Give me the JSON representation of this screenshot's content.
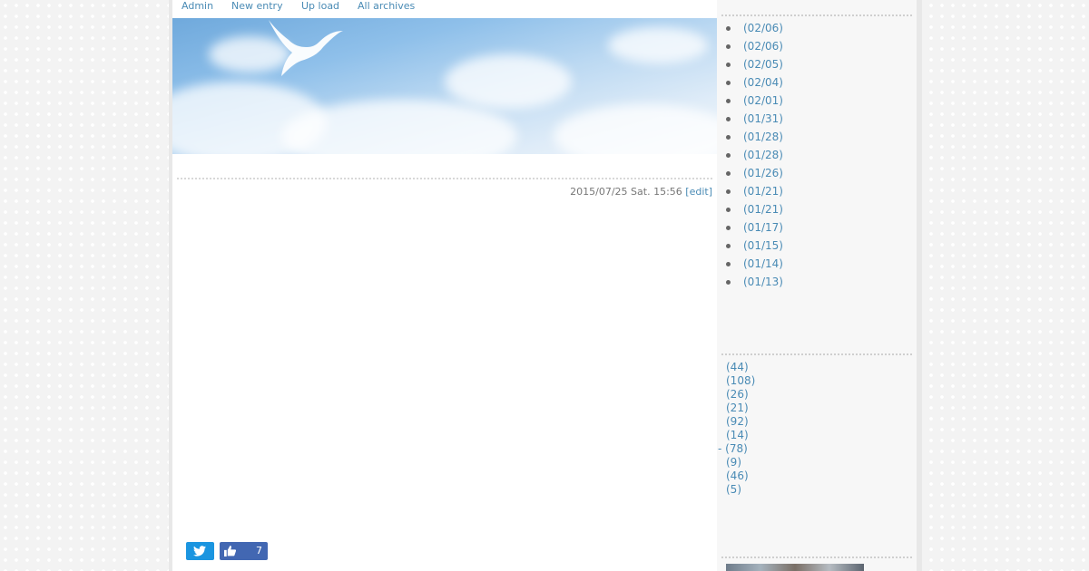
{
  "topnav": {
    "items": [
      {
        "label": "Admin"
      },
      {
        "label": "New entry"
      },
      {
        "label": "Up load"
      },
      {
        "label": "All archives"
      }
    ]
  },
  "entry": {
    "date": "2015/07/25 Sat. 15:56",
    "edit_label": "[edit]",
    "like_count": "7"
  },
  "sidebar": {
    "recent_dates": [
      "(02/06)",
      "(02/06)",
      "(02/05)",
      "(02/04)",
      "(02/01)",
      "(01/31)",
      "(01/28)",
      "(01/28)",
      "(01/26)",
      "(01/21)",
      "(01/21)",
      "(01/17)",
      "(01/15)",
      "(01/14)",
      "(01/13)"
    ],
    "category_counts": [
      "(44)",
      "(108)",
      "(26)",
      "(21)",
      "(92)",
      "(14)",
      "- (78)",
      "(9)",
      "(46)",
      "(5)"
    ]
  },
  "icons": {
    "twitter": "twitter-icon",
    "like": "thumbs-up-icon",
    "bird": "bird-logo-icon"
  },
  "colors": {
    "link": "#4a8bb5",
    "twitter": "#1b95e0",
    "facebook": "#4267b2"
  }
}
